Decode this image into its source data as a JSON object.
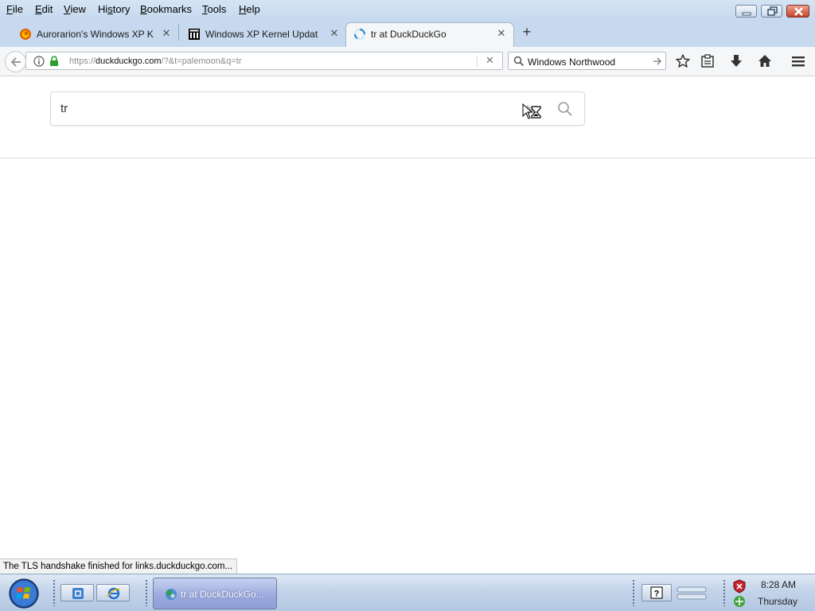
{
  "menu": {
    "items": [
      {
        "underline": "F",
        "rest": "ile"
      },
      {
        "underline": "E",
        "rest": "dit"
      },
      {
        "underline": "V",
        "rest": "iew"
      },
      {
        "prefix": "Hi",
        "underline": "s",
        "rest": "tory"
      },
      {
        "underline": "B",
        "rest": "ookmarks"
      },
      {
        "underline": "T",
        "rest": "ools"
      },
      {
        "underline": "H",
        "rest": "elp"
      }
    ]
  },
  "tabs": [
    {
      "title": "Aurorarion's Windows XP K",
      "icon": "firefox-icon",
      "active": false
    },
    {
      "title": "Windows XP Kernel Updat",
      "icon": "archive-icon",
      "active": false
    },
    {
      "title": "tr at DuckDuckGo",
      "icon": "loading-spinner-icon",
      "active": true
    }
  ],
  "newtab_label": "+",
  "urlbar": {
    "scheme": "https://",
    "host": "duckduckgo.com",
    "path": "/?&t=palemoon&q=tr"
  },
  "searchbar": {
    "value": "Windows Northwood"
  },
  "page": {
    "query": "tr"
  },
  "status_text": "The TLS handshake finished for links.duckduckgo.com...",
  "taskbar": {
    "task_label": "tr at DuckDuckGo...",
    "time": "8:28 AM",
    "day": "Thursday"
  },
  "colors": {
    "menubar": "#c6d9ee",
    "active_tab": "#f5f6f7",
    "lock_green": "#2e9e2e",
    "spinner_blue": "#2a8fd6"
  }
}
